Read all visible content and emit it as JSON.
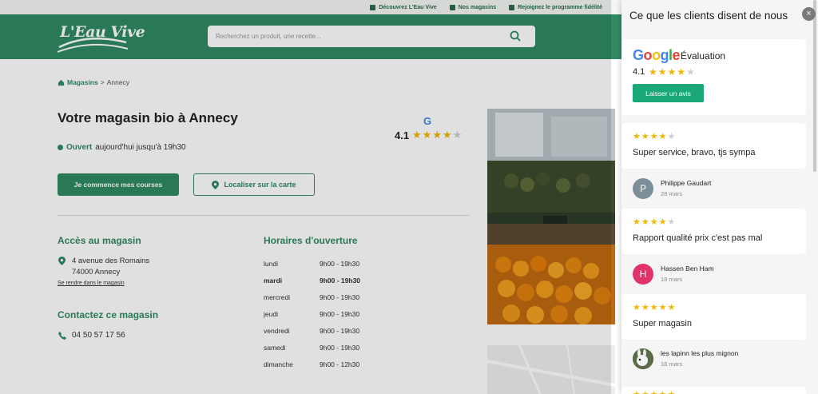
{
  "topbar": {
    "links": [
      {
        "label": "Découvrez L'Eau Vive",
        "icon": "leaf-icon"
      },
      {
        "label": "Nos magasins",
        "icon": "store-icon"
      },
      {
        "label": "Rejoignez le programme fidélité",
        "icon": "card-icon"
      }
    ]
  },
  "header": {
    "logo_text": "L'Eau Vive",
    "search_placeholder": "Recherchez un produit, une recette..."
  },
  "breadcrumb": {
    "home": "Magasins",
    "separator": ">",
    "current": "Annecy"
  },
  "store": {
    "title": "Votre magasin bio à Annecy",
    "rating_value": "4.1",
    "rating_stars": 4,
    "google_letter": "G",
    "status": "Ouvert",
    "status_detail": "aujourd'hui jusqu'à 19h30",
    "btn_courses": "Je commence mes courses",
    "btn_localiser": "Localiser sur la carte"
  },
  "access": {
    "title": "Accès au magasin",
    "line1": "4 avenue des Romains",
    "line2": "74000 Annecy",
    "link": "Se rendre dans le magasin"
  },
  "contact": {
    "title": "Contactez ce magasin",
    "phone": "04 50 57 17 56"
  },
  "hours": {
    "title": "Horaires d'ouverture",
    "rows": [
      {
        "day": "lundi",
        "time": "9h00 - 19h30"
      },
      {
        "day": "mardi",
        "time": "9h00 - 19h30"
      },
      {
        "day": "mercredi",
        "time": "9h00 - 19h30"
      },
      {
        "day": "jeudi",
        "time": "9h00 - 19h30"
      },
      {
        "day": "vendredi",
        "time": "9h00 - 19h30"
      },
      {
        "day": "samedi",
        "time": "9h00 - 19h30"
      },
      {
        "day": "dimanche",
        "time": "9h00 - 12h30"
      }
    ]
  },
  "panel": {
    "title": "Ce que les clients disent de nous",
    "close": "×",
    "google_word": "Google",
    "eval_label": "Évaluation",
    "rating_value": "4.1",
    "rating_stars": 4,
    "btn_avis": "Laisser un avis",
    "reviews": [
      {
        "stars": 4,
        "text": "Super service, bravo, tjs sympa",
        "author": "Philippe Gaudart",
        "date": "28 mars",
        "initial": "P",
        "avatar_color": "#7c8e99"
      },
      {
        "stars": 4,
        "text": "Rapport qualité prix c'est pas mal",
        "author": "Hassen Ben Ham",
        "date": "18 mars",
        "initial": "H",
        "avatar_color": "#e2326a"
      },
      {
        "stars": 5,
        "text": "Super magasin",
        "author": "les lapinn les plus mignon",
        "date": "18 mars",
        "initial": "",
        "avatar_color": "#4b5b3b"
      }
    ]
  },
  "colors": {
    "brand": "#2f8a62",
    "star": "#f2b600",
    "button": "#1ba879"
  }
}
